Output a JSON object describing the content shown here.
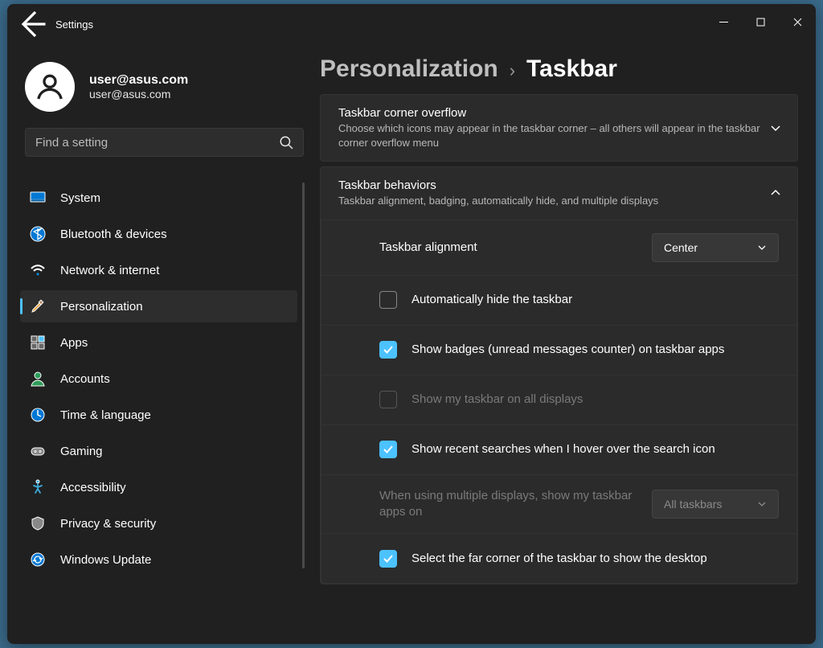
{
  "titlebar": {
    "title": "Settings"
  },
  "user": {
    "name": "user@asus.com",
    "email": "user@asus.com"
  },
  "search": {
    "placeholder": "Find a setting"
  },
  "nav": {
    "items": [
      {
        "label": "System"
      },
      {
        "label": "Bluetooth & devices"
      },
      {
        "label": "Network & internet"
      },
      {
        "label": "Personalization"
      },
      {
        "label": "Apps"
      },
      {
        "label": "Accounts"
      },
      {
        "label": "Time & language"
      },
      {
        "label": "Gaming"
      },
      {
        "label": "Accessibility"
      },
      {
        "label": "Privacy & security"
      },
      {
        "label": "Windows Update"
      }
    ],
    "selected_index": 3
  },
  "breadcrumb": {
    "parent": "Personalization",
    "current": "Taskbar"
  },
  "cards": {
    "overflow": {
      "title": "Taskbar corner overflow",
      "subtitle": "Choose which icons may appear in the taskbar corner – all others will appear in the taskbar corner overflow menu"
    },
    "behaviors": {
      "title": "Taskbar behaviors",
      "subtitle": "Taskbar alignment, badging, automatically hide, and multiple displays"
    }
  },
  "behaviors": {
    "alignment": {
      "label": "Taskbar alignment",
      "value": "Center"
    },
    "auto_hide": {
      "label": "Automatically hide the taskbar",
      "checked": false
    },
    "badges": {
      "label": "Show badges (unread messages counter) on taskbar apps",
      "checked": true
    },
    "all_displays": {
      "label": "Show my taskbar on all displays",
      "checked": false,
      "disabled": true
    },
    "recent_searches": {
      "label": "Show recent searches when I hover over the search icon",
      "checked": true
    },
    "multi_display_apps": {
      "label": "When using multiple displays, show my taskbar apps on",
      "value": "All taskbars",
      "disabled": true
    },
    "far_corner": {
      "label": "Select the far corner of the taskbar to show the desktop",
      "checked": true
    }
  }
}
